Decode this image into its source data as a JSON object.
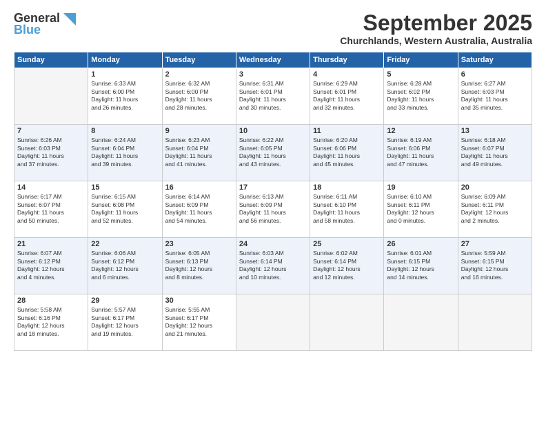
{
  "header": {
    "logo_general": "General",
    "logo_blue": "Blue",
    "month": "September 2025",
    "location": "Churchlands, Western Australia, Australia"
  },
  "weekdays": [
    "Sunday",
    "Monday",
    "Tuesday",
    "Wednesday",
    "Thursday",
    "Friday",
    "Saturday"
  ],
  "weeks": [
    [
      {
        "day": "",
        "info": ""
      },
      {
        "day": "1",
        "info": "Sunrise: 6:33 AM\nSunset: 6:00 PM\nDaylight: 11 hours\nand 26 minutes."
      },
      {
        "day": "2",
        "info": "Sunrise: 6:32 AM\nSunset: 6:00 PM\nDaylight: 11 hours\nand 28 minutes."
      },
      {
        "day": "3",
        "info": "Sunrise: 6:31 AM\nSunset: 6:01 PM\nDaylight: 11 hours\nand 30 minutes."
      },
      {
        "day": "4",
        "info": "Sunrise: 6:29 AM\nSunset: 6:01 PM\nDaylight: 11 hours\nand 32 minutes."
      },
      {
        "day": "5",
        "info": "Sunrise: 6:28 AM\nSunset: 6:02 PM\nDaylight: 11 hours\nand 33 minutes."
      },
      {
        "day": "6",
        "info": "Sunrise: 6:27 AM\nSunset: 6:03 PM\nDaylight: 11 hours\nand 35 minutes."
      }
    ],
    [
      {
        "day": "7",
        "info": "Sunrise: 6:26 AM\nSunset: 6:03 PM\nDaylight: 11 hours\nand 37 minutes."
      },
      {
        "day": "8",
        "info": "Sunrise: 6:24 AM\nSunset: 6:04 PM\nDaylight: 11 hours\nand 39 minutes."
      },
      {
        "day": "9",
        "info": "Sunrise: 6:23 AM\nSunset: 6:04 PM\nDaylight: 11 hours\nand 41 minutes."
      },
      {
        "day": "10",
        "info": "Sunrise: 6:22 AM\nSunset: 6:05 PM\nDaylight: 11 hours\nand 43 minutes."
      },
      {
        "day": "11",
        "info": "Sunrise: 6:20 AM\nSunset: 6:06 PM\nDaylight: 11 hours\nand 45 minutes."
      },
      {
        "day": "12",
        "info": "Sunrise: 6:19 AM\nSunset: 6:06 PM\nDaylight: 11 hours\nand 47 minutes."
      },
      {
        "day": "13",
        "info": "Sunrise: 6:18 AM\nSunset: 6:07 PM\nDaylight: 11 hours\nand 49 minutes."
      }
    ],
    [
      {
        "day": "14",
        "info": "Sunrise: 6:17 AM\nSunset: 6:07 PM\nDaylight: 11 hours\nand 50 minutes."
      },
      {
        "day": "15",
        "info": "Sunrise: 6:15 AM\nSunset: 6:08 PM\nDaylight: 11 hours\nand 52 minutes."
      },
      {
        "day": "16",
        "info": "Sunrise: 6:14 AM\nSunset: 6:09 PM\nDaylight: 11 hours\nand 54 minutes."
      },
      {
        "day": "17",
        "info": "Sunrise: 6:13 AM\nSunset: 6:09 PM\nDaylight: 11 hours\nand 56 minutes."
      },
      {
        "day": "18",
        "info": "Sunrise: 6:11 AM\nSunset: 6:10 PM\nDaylight: 11 hours\nand 58 minutes."
      },
      {
        "day": "19",
        "info": "Sunrise: 6:10 AM\nSunset: 6:11 PM\nDaylight: 12 hours\nand 0 minutes."
      },
      {
        "day": "20",
        "info": "Sunrise: 6:09 AM\nSunset: 6:11 PM\nDaylight: 12 hours\nand 2 minutes."
      }
    ],
    [
      {
        "day": "21",
        "info": "Sunrise: 6:07 AM\nSunset: 6:12 PM\nDaylight: 12 hours\nand 4 minutes."
      },
      {
        "day": "22",
        "info": "Sunrise: 6:06 AM\nSunset: 6:12 PM\nDaylight: 12 hours\nand 6 minutes."
      },
      {
        "day": "23",
        "info": "Sunrise: 6:05 AM\nSunset: 6:13 PM\nDaylight: 12 hours\nand 8 minutes."
      },
      {
        "day": "24",
        "info": "Sunrise: 6:03 AM\nSunset: 6:14 PM\nDaylight: 12 hours\nand 10 minutes."
      },
      {
        "day": "25",
        "info": "Sunrise: 6:02 AM\nSunset: 6:14 PM\nDaylight: 12 hours\nand 12 minutes."
      },
      {
        "day": "26",
        "info": "Sunrise: 6:01 AM\nSunset: 6:15 PM\nDaylight: 12 hours\nand 14 minutes."
      },
      {
        "day": "27",
        "info": "Sunrise: 5:59 AM\nSunset: 6:15 PM\nDaylight: 12 hours\nand 16 minutes."
      }
    ],
    [
      {
        "day": "28",
        "info": "Sunrise: 5:58 AM\nSunset: 6:16 PM\nDaylight: 12 hours\nand 18 minutes."
      },
      {
        "day": "29",
        "info": "Sunrise: 5:57 AM\nSunset: 6:17 PM\nDaylight: 12 hours\nand 19 minutes."
      },
      {
        "day": "30",
        "info": "Sunrise: 5:55 AM\nSunset: 6:17 PM\nDaylight: 12 hours\nand 21 minutes."
      },
      {
        "day": "",
        "info": ""
      },
      {
        "day": "",
        "info": ""
      },
      {
        "day": "",
        "info": ""
      },
      {
        "day": "",
        "info": ""
      }
    ]
  ]
}
